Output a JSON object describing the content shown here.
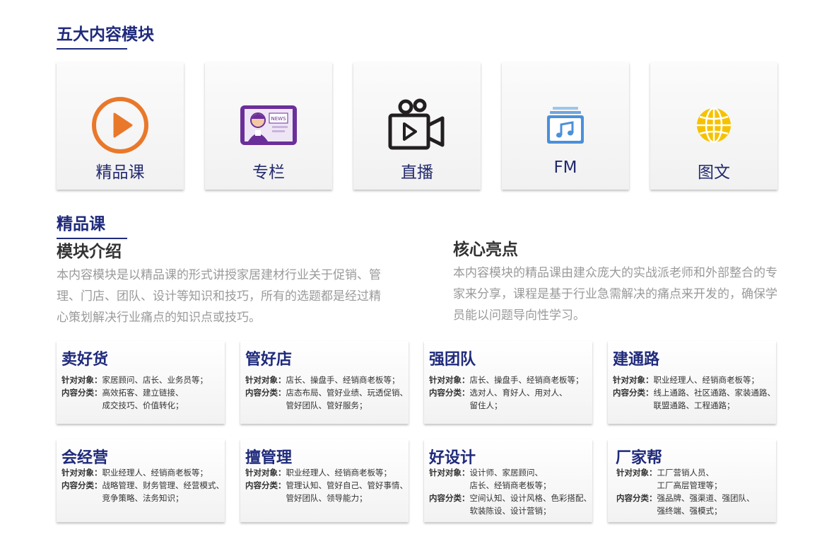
{
  "header": {
    "title": "五大内容模块"
  },
  "modules": [
    {
      "label": "精品课",
      "icon": "play-circle-icon"
    },
    {
      "label": "专栏",
      "icon": "news-tablet-icon"
    },
    {
      "label": "直播",
      "icon": "video-camera-icon"
    },
    {
      "label": "FM",
      "icon": "music-album-icon"
    },
    {
      "label": "图文",
      "icon": "globe-icon"
    }
  ],
  "section": {
    "title": "精品课",
    "intro_title": "模块介绍",
    "intro_text": "本内容模块是以精品课的形式讲授家居建材行业关于促销、管理、门店、团队、设计等知识和技巧，所有的选题都是经过精心策划解决行业痛点的知识点或技巧。",
    "core_title": "核心亮点",
    "core_text": "本内容模块的精品课由建众庞大的实战派老师和外部整合的专家来分享，课程是基于行业急需解决的痛点来开发的，确保学员能以问题导向性学习。"
  },
  "labels": {
    "target": "针对对象：",
    "category": "内容分类："
  },
  "courses": [
    {
      "title": "卖好货",
      "target": "家居顾问、店长、业务员等；",
      "category": "高效拓客、建立链接、\n成交技巧、价值转化；"
    },
    {
      "title": "管好店",
      "target": "店长、操盘手、经销商老板等；",
      "category": "店态布局、管好业绩、玩透促销、\n管好团队、管好服务；"
    },
    {
      "title": "强团队",
      "target": "店长、操盘手、经销商老板等；",
      "category": "选对人、育好人、用对人、\n留住人；"
    },
    {
      "title": "建通路",
      "target": "职业经理人、经销商老板等；",
      "category": "线上通路、社区通路、家装通路、\n联盟通路、工程通路；"
    },
    {
      "title": "会经营",
      "target": "职业经理人、经销商老板等；",
      "category": "战略管理、财务管理、经营模式、\n竞争策略、法务知识；"
    },
    {
      "title": "擅管理",
      "target": "职业经理人、经销商老板等；",
      "category": "管理认知、管好自己、管好事情、\n管好团队、领导能力；"
    },
    {
      "title": "好设计",
      "target": "设计师、家居顾问、\n店长、经销商老板等；",
      "category": "空间认知、设计风格、色彩搭配、\n软装陈设、设计营销；"
    },
    {
      "title": "厂家帮",
      "target": "工厂营销人员、\n工厂高层管理等；",
      "category": "强品牌、强渠道、强团队、\n强终端、强模式；"
    }
  ]
}
